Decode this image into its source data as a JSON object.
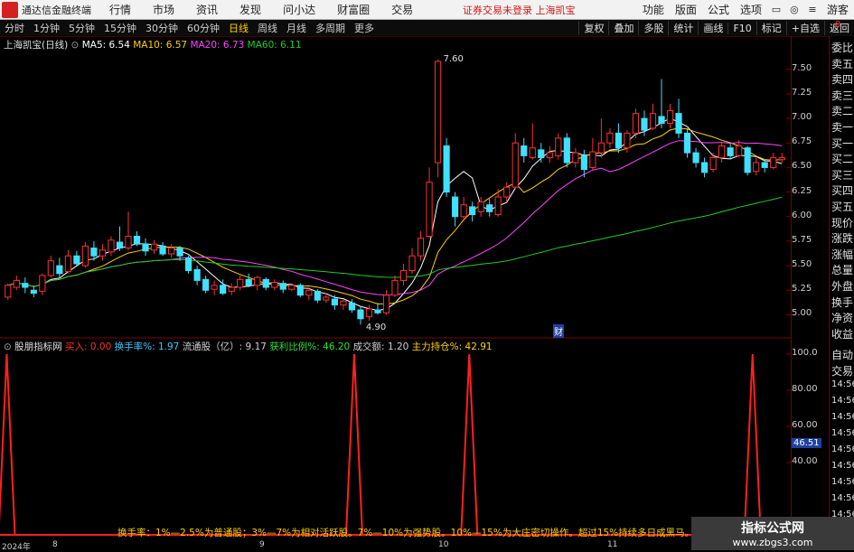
{
  "menubar": {
    "app_name": "通达信金融终端",
    "items": [
      "行情",
      "市场",
      "资讯",
      "发现",
      "问小达",
      "财富圈",
      "交易"
    ],
    "notice": "证券交易未登录  上海凯宝",
    "right_items": [
      "功能",
      "版面",
      "公式",
      "选项",
      "游客"
    ]
  },
  "toolbar": {
    "periods": [
      "分时",
      "1分钟",
      "5分钟",
      "15分钟",
      "30分钟",
      "60分钟",
      "日线",
      "周线",
      "月线",
      "多周期",
      "更多"
    ],
    "active_period": "日线",
    "buttons": [
      "复权",
      "叠加",
      "多股",
      "统计",
      "画线",
      "F10",
      "标记",
      "+自选",
      "返回"
    ]
  },
  "main_chart": {
    "stock": "上海凯宝(日线)",
    "ma_labels": [
      {
        "text": "MA5: 6.54",
        "color": "#ffffff"
      },
      {
        "text": "MA10: 6.57",
        "color": "#ffd000"
      },
      {
        "text": "MA20: 6.73",
        "color": "#ff44ff"
      },
      {
        "text": "MA60: 6.11",
        "color": "#22cc22"
      }
    ],
    "y_ticks": [
      "7.50",
      "7.25",
      "7.00",
      "6.75",
      "6.50",
      "6.25",
      "6.00",
      "5.75",
      "5.50",
      "5.25",
      "5.00"
    ],
    "y_range": [
      4.82,
      7.7
    ],
    "high_label": "7.60",
    "low_label": "4.90",
    "event_mark": "财",
    "candles": [
      [
        5.18,
        5.3,
        5.32,
        5.15
      ],
      [
        5.28,
        5.35,
        5.4,
        5.25
      ],
      [
        5.32,
        5.28,
        5.38,
        5.22
      ],
      [
        5.25,
        5.22,
        5.3,
        5.18
      ],
      [
        5.24,
        5.4,
        5.42,
        5.2
      ],
      [
        5.4,
        5.55,
        5.6,
        5.38
      ],
      [
        5.5,
        5.42,
        5.58,
        5.38
      ],
      [
        5.44,
        5.6,
        5.66,
        5.42
      ],
      [
        5.6,
        5.52,
        5.65,
        5.5
      ],
      [
        5.5,
        5.7,
        5.74,
        5.48
      ],
      [
        5.68,
        5.6,
        5.75,
        5.55
      ],
      [
        5.6,
        5.66,
        5.72,
        5.55
      ],
      [
        5.64,
        5.76,
        5.8,
        5.6
      ],
      [
        5.74,
        5.68,
        5.9,
        5.65
      ],
      [
        5.68,
        5.8,
        6.05,
        5.66
      ],
      [
        5.8,
        5.72,
        5.85,
        5.7
      ],
      [
        5.72,
        5.65,
        5.78,
        5.6
      ],
      [
        5.66,
        5.72,
        5.76,
        5.62
      ],
      [
        5.7,
        5.62,
        5.74,
        5.6
      ],
      [
        5.62,
        5.68,
        5.72,
        5.58
      ],
      [
        5.68,
        5.6,
        5.7,
        5.55
      ],
      [
        5.58,
        5.45,
        5.6,
        5.42
      ],
      [
        5.46,
        5.35,
        5.5,
        5.3
      ],
      [
        5.36,
        5.25,
        5.4,
        5.22
      ],
      [
        5.26,
        5.3,
        5.35,
        5.2
      ],
      [
        5.3,
        5.22,
        5.36,
        5.2
      ],
      [
        5.24,
        5.28,
        5.32,
        5.2
      ],
      [
        5.28,
        5.36,
        5.4,
        5.25
      ],
      [
        5.36,
        5.3,
        5.42,
        5.28
      ],
      [
        5.3,
        5.38,
        5.4,
        5.25
      ],
      [
        5.36,
        5.28,
        5.38,
        5.25
      ],
      [
        5.28,
        5.33,
        5.36,
        5.25
      ],
      [
        5.32,
        5.26,
        5.35,
        5.22
      ],
      [
        5.26,
        5.3,
        5.32,
        5.24
      ],
      [
        5.3,
        5.2,
        5.32,
        5.18
      ],
      [
        5.2,
        5.25,
        5.28,
        5.15
      ],
      [
        5.24,
        5.15,
        5.26,
        5.12
      ],
      [
        5.15,
        5.18,
        5.22,
        5.12
      ],
      [
        5.16,
        5.1,
        5.2,
        5.05
      ],
      [
        5.1,
        5.14,
        5.16,
        5.05
      ],
      [
        5.12,
        5.05,
        5.16,
        5.02
      ],
      [
        5.05,
        4.96,
        5.08,
        4.9
      ],
      [
        4.98,
        5.06,
        5.1,
        4.94
      ],
      [
        5.05,
        5.02,
        5.12,
        5.0
      ],
      [
        5.02,
        5.2,
        5.25,
        5.0
      ],
      [
        5.2,
        5.35,
        5.4,
        5.18
      ],
      [
        5.35,
        5.45,
        5.52,
        5.3
      ],
      [
        5.45,
        5.6,
        5.68,
        5.42
      ],
      [
        5.6,
        5.78,
        5.85,
        5.55
      ],
      [
        5.8,
        6.35,
        6.5,
        5.78
      ],
      [
        6.55,
        7.58,
        7.6,
        6.4
      ],
      [
        6.72,
        6.25,
        6.8,
        6.2
      ],
      [
        6.2,
        6.0,
        6.25,
        5.9
      ],
      [
        6.0,
        6.12,
        6.2,
        5.95
      ],
      [
        6.1,
        6.02,
        6.15,
        5.95
      ],
      [
        6.05,
        6.15,
        6.2,
        6.0
      ],
      [
        6.12,
        6.05,
        6.18,
        6.0
      ],
      [
        6.02,
        6.2,
        6.28,
        6.0
      ],
      [
        6.2,
        6.3,
        6.35,
        6.15
      ],
      [
        6.3,
        6.75,
        6.85,
        6.28
      ],
      [
        6.72,
        6.62,
        6.8,
        6.55
      ],
      [
        6.6,
        6.7,
        6.95,
        6.58
      ],
      [
        6.68,
        6.6,
        6.75,
        6.55
      ],
      [
        6.6,
        6.65,
        6.72,
        6.55
      ],
      [
        6.62,
        6.8,
        6.85,
        6.58
      ],
      [
        6.8,
        6.55,
        6.85,
        6.5
      ],
      [
        6.55,
        6.65,
        6.7,
        6.5
      ],
      [
        6.62,
        6.48,
        6.68,
        6.4
      ],
      [
        6.5,
        6.66,
        6.8,
        6.48
      ],
      [
        6.65,
        6.75,
        7.0,
        6.6
      ],
      [
        6.75,
        6.85,
        6.9,
        6.7
      ],
      [
        6.85,
        6.7,
        6.95,
        6.65
      ],
      [
        6.7,
        6.85,
        6.88,
        6.65
      ],
      [
        6.85,
        7.05,
        7.1,
        6.8
      ],
      [
        7.0,
        6.88,
        7.08,
        6.82
      ],
      [
        6.9,
        7.05,
        7.15,
        6.88
      ],
      [
        7.02,
        6.95,
        7.4,
        6.9
      ],
      [
        6.95,
        7.08,
        7.15,
        6.9
      ],
      [
        7.05,
        6.85,
        7.2,
        6.8
      ],
      [
        6.85,
        6.65,
        6.9,
        6.6
      ],
      [
        6.65,
        6.55,
        6.7,
        6.5
      ],
      [
        6.55,
        6.45,
        6.6,
        6.4
      ],
      [
        6.48,
        6.6,
        6.65,
        6.45
      ],
      [
        6.6,
        6.72,
        6.75,
        6.55
      ],
      [
        6.7,
        6.62,
        6.75,
        6.58
      ],
      [
        6.62,
        6.72,
        6.78,
        6.6
      ],
      [
        6.7,
        6.45,
        6.72,
        6.42
      ],
      [
        6.46,
        6.55,
        6.6,
        6.42
      ],
      [
        6.55,
        6.5,
        6.58,
        6.45
      ],
      [
        6.5,
        6.6,
        6.65,
        6.48
      ],
      [
        6.58,
        6.6,
        6.65,
        6.55
      ]
    ]
  },
  "indicator": {
    "name": "股朋指标网",
    "fields": [
      {
        "text": "买入: 0.00",
        "color": "#ff3030"
      },
      {
        "text": "换手率%: 1.97",
        "color": "#40c8ff"
      },
      {
        "text": "流通股（亿）: 9.17",
        "color": "#d0d0d0"
      },
      {
        "text": "获利比例%: 46.20",
        "color": "#30e030"
      },
      {
        "text": "成交额: 1.20",
        "color": "#d0d0d0"
      },
      {
        "text": "主力持仓%: 42.91",
        "color": "#ffd000"
      }
    ],
    "y_ticks": [
      "100.0",
      "80.00",
      "60.00",
      "40.00"
    ],
    "y_range": [
      0,
      100
    ],
    "current_value": "46.51",
    "note": "换手率：1%—2.5%为普通股；3%—7%为相对活跃股。7%—10%为强势股。10%—15%为大庄密切操作。超过15%持续多日成黑马。",
    "spike_fractions": [
      0.004,
      0.448,
      0.595,
      0.957
    ]
  },
  "right_panel": {
    "top_value": "0.",
    "labels": [
      "委比",
      "卖五",
      "卖四",
      "卖三",
      "卖二",
      "卖一",
      "买一",
      "买二",
      "买三",
      "买四",
      "买五",
      "现价",
      "涨跌",
      "涨幅",
      "总量",
      "外盘",
      "换手",
      "净资",
      "收益"
    ],
    "lower_labels": [
      "自动",
      "交易",
      "14:56",
      "14:56",
      "14:56",
      "14:56",
      "14:56",
      "14:56",
      "14:56",
      "14:56",
      "14:56"
    ]
  },
  "dates": [
    "2024年",
    "8",
    "9",
    "10",
    "11"
  ],
  "watermark": {
    "line1": "指标公式网",
    "line2": "www.zbgs3.com"
  },
  "colors": {
    "up": "#ff3030",
    "down": "#40e0ff",
    "border": "#7a0000"
  }
}
